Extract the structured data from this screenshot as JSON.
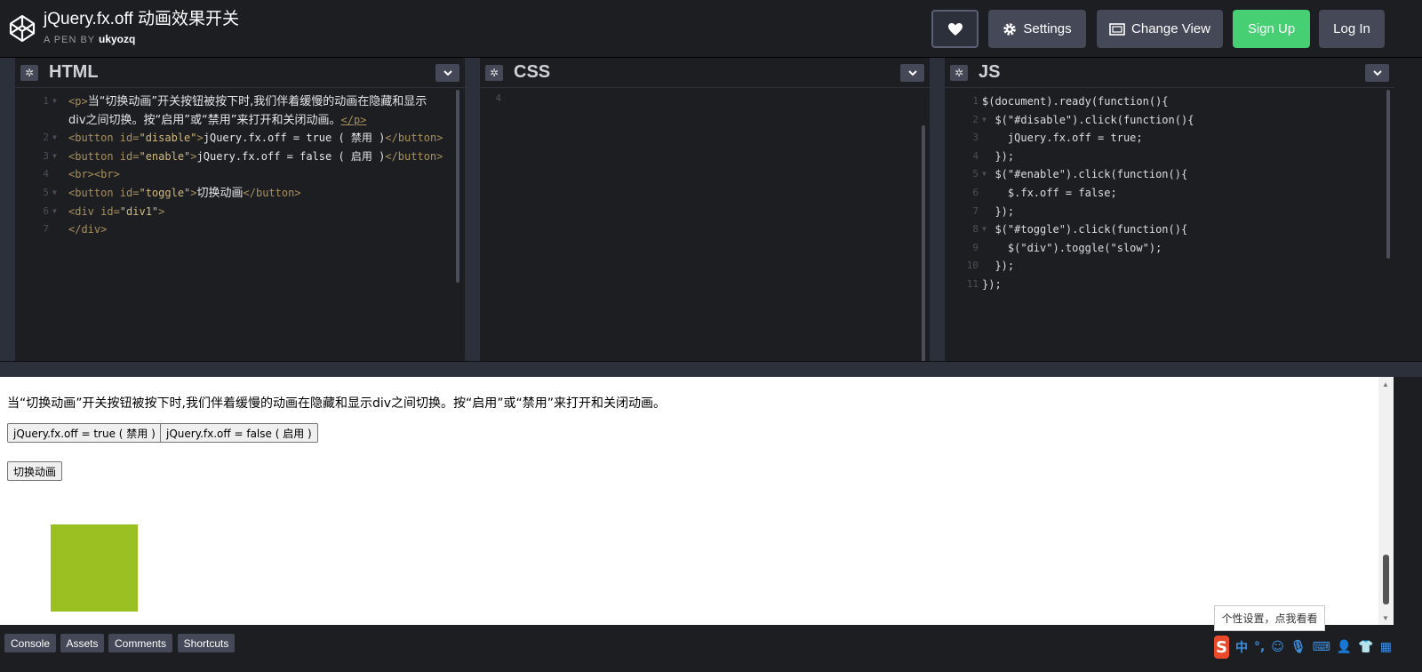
{
  "header": {
    "title": "jQuery.fx.off 动画效果开关",
    "pen_by_label": "A PEN BY",
    "author": "ukyozq",
    "settings_label": "Settings",
    "change_view_label": "Change View",
    "signup_label": "Sign Up",
    "login_label": "Log In"
  },
  "editors": {
    "html": {
      "label": "HTML",
      "line_numbers": [
        "1",
        "",
        "2",
        "3",
        "4",
        "5",
        "6",
        "7"
      ]
    },
    "css": {
      "label": "CSS",
      "line_numbers": [
        "4"
      ]
    },
    "js": {
      "label": "JS",
      "line_numbers": [
        "1",
        "2",
        "3",
        "4",
        "5",
        "6",
        "7",
        "8",
        "9",
        "10",
        "11"
      ]
    }
  },
  "html_code": {
    "l1a_text": "当“切换动画”开关按钮被按下时,我们伴着缓慢的动画在隐藏和显示",
    "l1b_text": "div之间切换。按“启用”或“禁用”来打开和关闭动画。",
    "l2_open": "<button id=",
    "l2_id": "\"disable\"",
    "l2_text": "jQuery.fx.off = true ( 禁用 )",
    "l3_open": "<button id=",
    "l3_id": "\"enable\"",
    "l3_text": "jQuery.fx.off = false ( 启用 )",
    "l4": "<br><br>",
    "l5_open": "<button id=",
    "l5_id": "\"toggle\"",
    "l5_text": "切换动画",
    "l6_open": "<div id=",
    "l6_id": "\"div1\"",
    "l7": "</div>",
    "p_open": "<p>",
    "p_close": "</p>",
    "close_gt": ">",
    "button_close": "</button>"
  },
  "js_code": [
    "$(document).ready(function(){",
    "  $(\"#disable\").click(function(){",
    "    jQuery.fx.off = true;",
    "  });",
    "  $(\"#enable\").click(function(){",
    "    $.fx.off = false;",
    "  });",
    "  $(\"#toggle\").click(function(){",
    "    $(\"div\").toggle(\"slow\");",
    "  });",
    "});"
  ],
  "result": {
    "paragraph": "当“切换动画”开关按钮被按下时,我们伴着缓慢的动画在隐藏和显示div之间切换。按“启用”或“禁用”来打开和关闭动画。",
    "disable_button": "jQuery.fx.off = true ( 禁用 )",
    "enable_button": "jQuery.fx.off = false ( 启用 )",
    "toggle_button": "切换动画",
    "box_color": "#9bc022"
  },
  "footer": {
    "console": "Console",
    "assets": "Assets",
    "comments": "Comments",
    "shortcuts": "Shortcuts"
  },
  "ime": {
    "tooltip": "个性设置，点我看看",
    "logo": "S",
    "lang": "中"
  }
}
